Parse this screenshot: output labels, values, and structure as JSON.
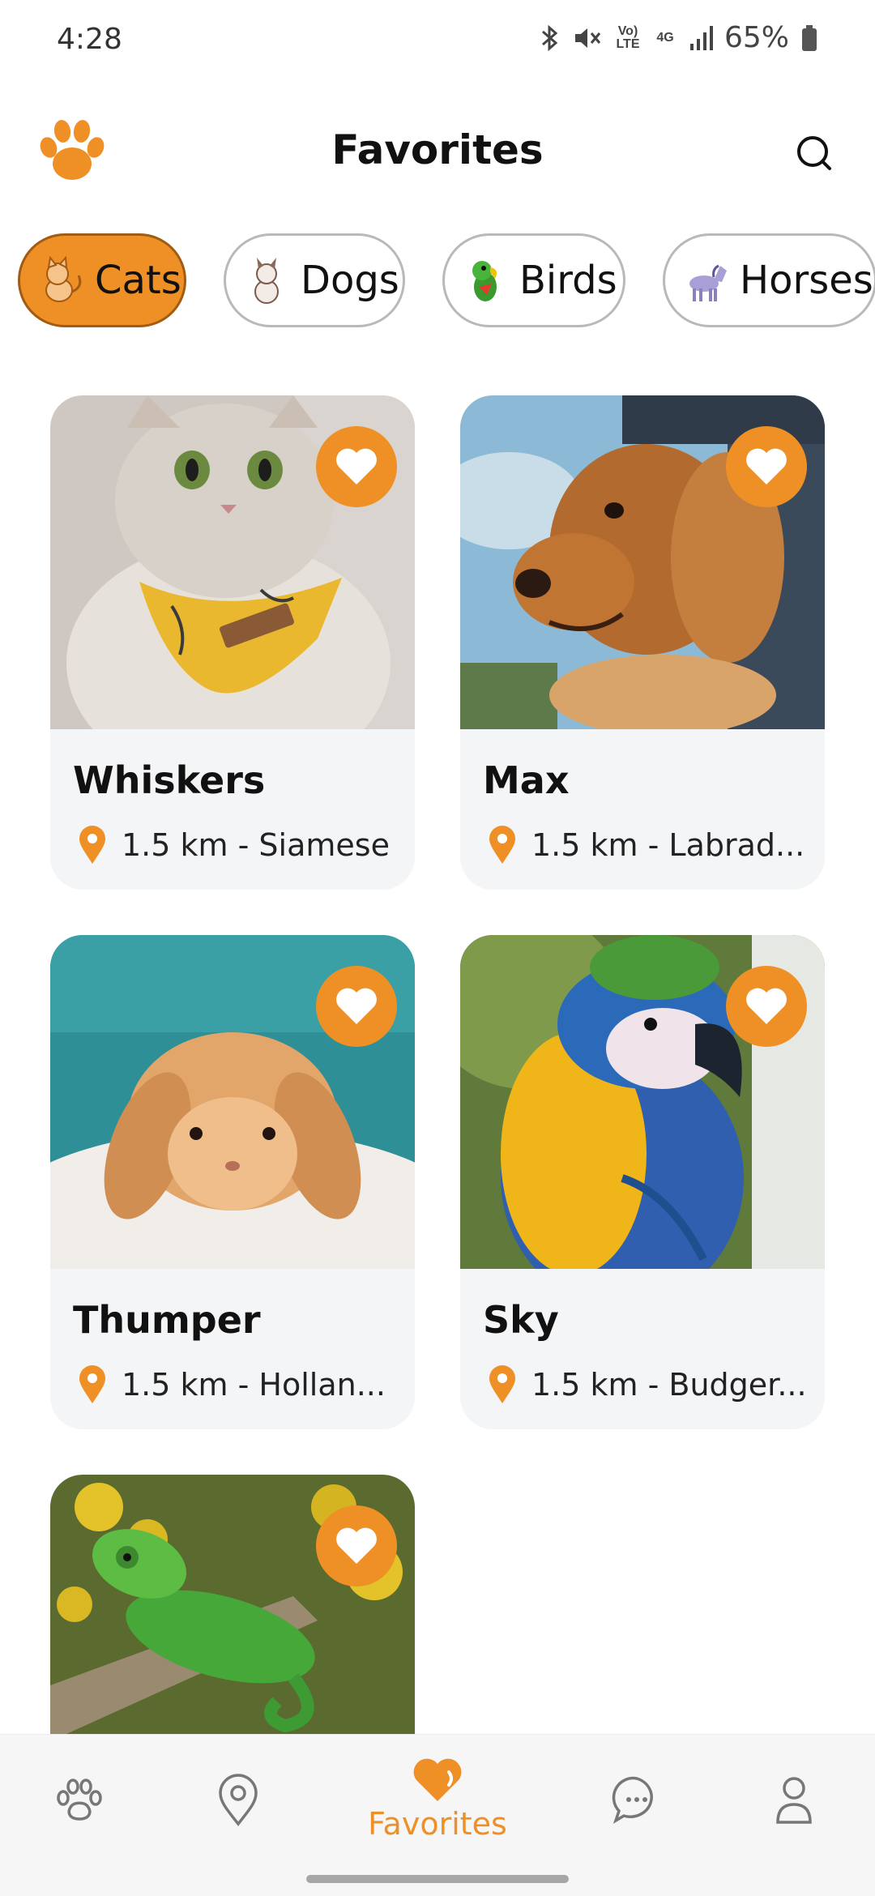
{
  "status_bar": {
    "time": "4:28",
    "battery": "65%",
    "icons": [
      "bluetooth-icon",
      "mute-icon",
      "volte-icon",
      "4g-icon",
      "signal-icon",
      "battery-icon"
    ],
    "volte_label": "Vo) LTE",
    "network_label": "4G"
  },
  "header": {
    "title": "Favorites",
    "logo_icon": "paw-icon",
    "search_icon": "search-icon"
  },
  "categories": [
    {
      "label": "Cats",
      "icon": "cat-icon",
      "active": true
    },
    {
      "label": "Dogs",
      "icon": "dog-icon",
      "active": false
    },
    {
      "label": "Birds",
      "icon": "parrot-icon",
      "active": false
    },
    {
      "label": "Horses",
      "icon": "horse-icon",
      "active": false
    }
  ],
  "pets": [
    {
      "name": "Whiskers",
      "meta": "1.5 km - Siamese",
      "photo": "cat-photo",
      "favorited": true
    },
    {
      "name": "Max",
      "meta": "1.5 km - Labrad...",
      "photo": "dog-photo",
      "favorited": true
    },
    {
      "name": "Thumper",
      "meta": "1.5 km - Hollan...",
      "photo": "rabbit-photo",
      "favorited": true
    },
    {
      "name": "Sky",
      "meta": "1.5 km - Budger...",
      "photo": "parrot-photo",
      "favorited": true
    },
    {
      "name": "",
      "meta": "",
      "photo": "chameleon-photo",
      "favorited": true
    }
  ],
  "bottom_nav": {
    "items": [
      {
        "icon": "paw-icon",
        "label": ""
      },
      {
        "icon": "location-pin-icon",
        "label": ""
      },
      {
        "icon": "heart-icon",
        "label": "Favorites",
        "active": true
      },
      {
        "icon": "chat-icon",
        "label": ""
      },
      {
        "icon": "user-icon",
        "label": ""
      }
    ]
  },
  "colors": {
    "accent": "#ef9027",
    "chip_border": "#b9b9b9",
    "card_bg": "#f4f5f7"
  }
}
